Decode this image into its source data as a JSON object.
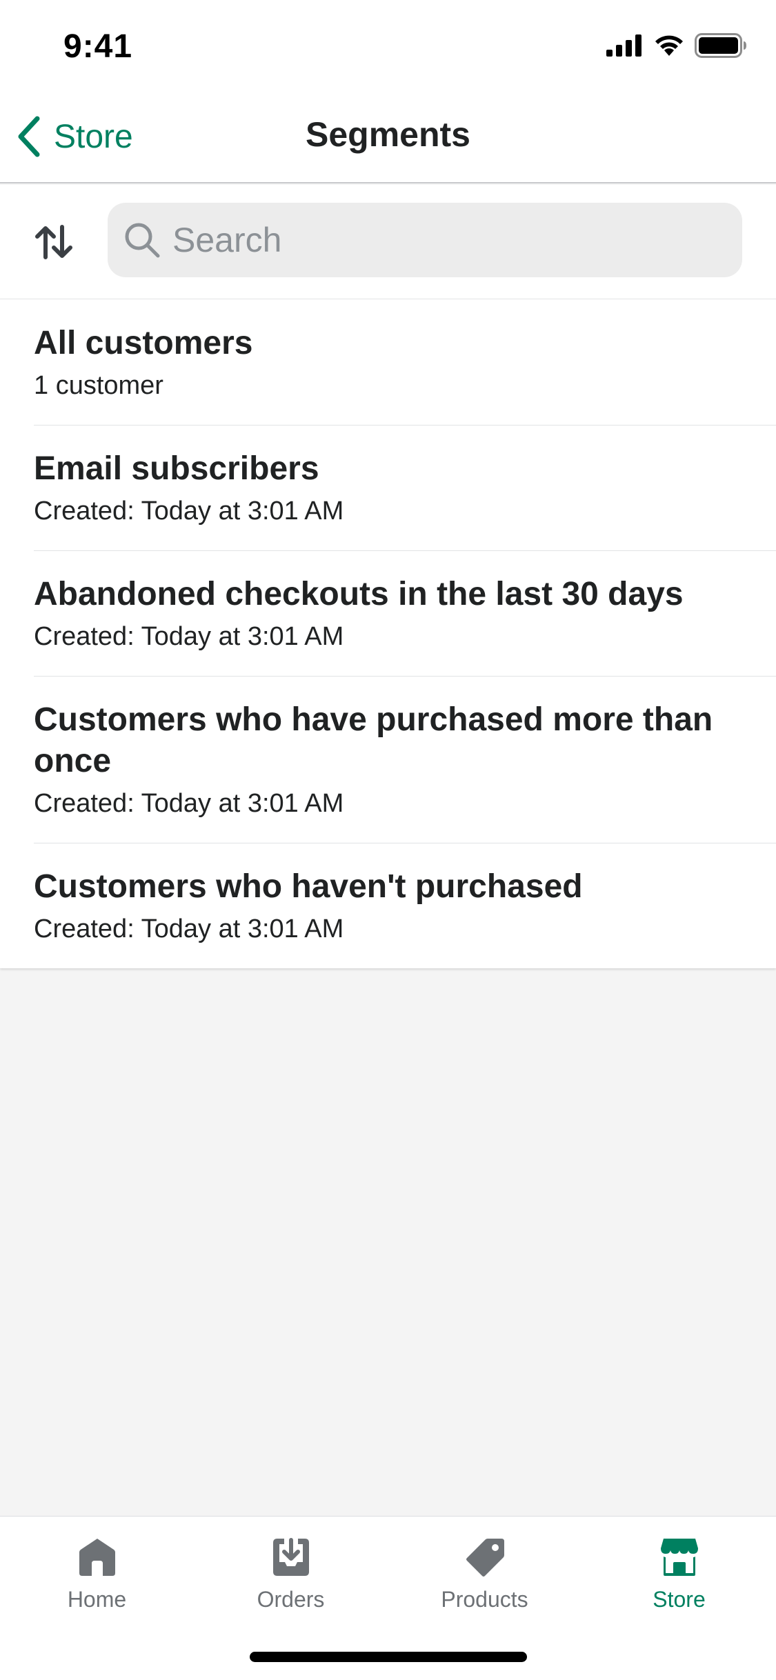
{
  "status_bar": {
    "time": "9:41"
  },
  "nav": {
    "back_label": "Store",
    "title": "Segments"
  },
  "search": {
    "placeholder": "Search",
    "value": ""
  },
  "segments": [
    {
      "title": "All customers",
      "subtitle": "1 customer"
    },
    {
      "title": "Email subscribers",
      "subtitle": "Created: Today at 3:01 AM"
    },
    {
      "title": "Abandoned checkouts in the last 30 days",
      "subtitle": "Created: Today at 3:01 AM"
    },
    {
      "title": "Customers who have purchased more than once",
      "subtitle": "Created: Today at 3:01 AM"
    },
    {
      "title": "Customers who haven't purchased",
      "subtitle": "Created: Today at 3:01 AM"
    }
  ],
  "tabs": [
    {
      "label": "Home",
      "icon": "home-icon",
      "active": false
    },
    {
      "label": "Orders",
      "icon": "orders-inbox-icon",
      "active": false
    },
    {
      "label": "Products",
      "icon": "tag-icon",
      "active": false
    },
    {
      "label": "Store",
      "icon": "store-icon",
      "active": true
    }
  ],
  "colors": {
    "accent": "#008060",
    "text": "#202223",
    "muted": "#6d7175",
    "background": "#f4f4f4",
    "search_bg": "#ececec"
  }
}
